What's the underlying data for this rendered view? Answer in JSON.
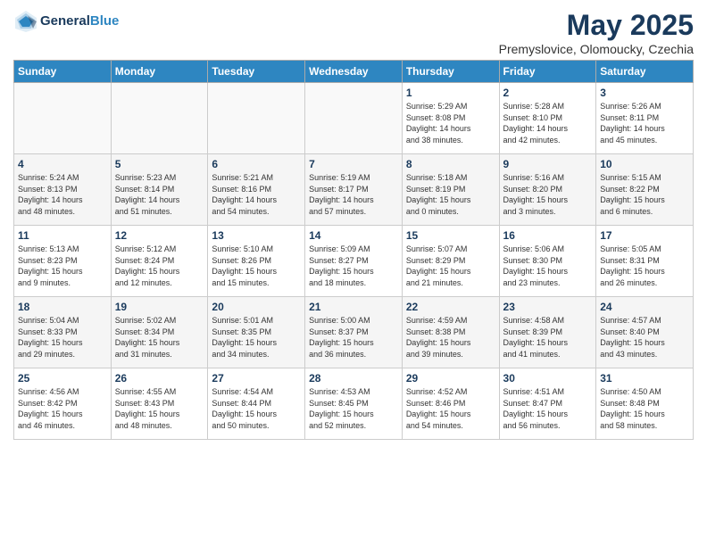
{
  "header": {
    "logo_line1": "General",
    "logo_line2": "Blue",
    "title": "May 2025",
    "subtitle": "Premyslovice, Olomoucky, Czechia"
  },
  "weekdays": [
    "Sunday",
    "Monday",
    "Tuesday",
    "Wednesday",
    "Thursday",
    "Friday",
    "Saturday"
  ],
  "weeks": [
    [
      {
        "day": "",
        "info": ""
      },
      {
        "day": "",
        "info": ""
      },
      {
        "day": "",
        "info": ""
      },
      {
        "day": "",
        "info": ""
      },
      {
        "day": "1",
        "info": "Sunrise: 5:29 AM\nSunset: 8:08 PM\nDaylight: 14 hours\nand 38 minutes."
      },
      {
        "day": "2",
        "info": "Sunrise: 5:28 AM\nSunset: 8:10 PM\nDaylight: 14 hours\nand 42 minutes."
      },
      {
        "day": "3",
        "info": "Sunrise: 5:26 AM\nSunset: 8:11 PM\nDaylight: 14 hours\nand 45 minutes."
      }
    ],
    [
      {
        "day": "4",
        "info": "Sunrise: 5:24 AM\nSunset: 8:13 PM\nDaylight: 14 hours\nand 48 minutes."
      },
      {
        "day": "5",
        "info": "Sunrise: 5:23 AM\nSunset: 8:14 PM\nDaylight: 14 hours\nand 51 minutes."
      },
      {
        "day": "6",
        "info": "Sunrise: 5:21 AM\nSunset: 8:16 PM\nDaylight: 14 hours\nand 54 minutes."
      },
      {
        "day": "7",
        "info": "Sunrise: 5:19 AM\nSunset: 8:17 PM\nDaylight: 14 hours\nand 57 minutes."
      },
      {
        "day": "8",
        "info": "Sunrise: 5:18 AM\nSunset: 8:19 PM\nDaylight: 15 hours\nand 0 minutes."
      },
      {
        "day": "9",
        "info": "Sunrise: 5:16 AM\nSunset: 8:20 PM\nDaylight: 15 hours\nand 3 minutes."
      },
      {
        "day": "10",
        "info": "Sunrise: 5:15 AM\nSunset: 8:22 PM\nDaylight: 15 hours\nand 6 minutes."
      }
    ],
    [
      {
        "day": "11",
        "info": "Sunrise: 5:13 AM\nSunset: 8:23 PM\nDaylight: 15 hours\nand 9 minutes."
      },
      {
        "day": "12",
        "info": "Sunrise: 5:12 AM\nSunset: 8:24 PM\nDaylight: 15 hours\nand 12 minutes."
      },
      {
        "day": "13",
        "info": "Sunrise: 5:10 AM\nSunset: 8:26 PM\nDaylight: 15 hours\nand 15 minutes."
      },
      {
        "day": "14",
        "info": "Sunrise: 5:09 AM\nSunset: 8:27 PM\nDaylight: 15 hours\nand 18 minutes."
      },
      {
        "day": "15",
        "info": "Sunrise: 5:07 AM\nSunset: 8:29 PM\nDaylight: 15 hours\nand 21 minutes."
      },
      {
        "day": "16",
        "info": "Sunrise: 5:06 AM\nSunset: 8:30 PM\nDaylight: 15 hours\nand 23 minutes."
      },
      {
        "day": "17",
        "info": "Sunrise: 5:05 AM\nSunset: 8:31 PM\nDaylight: 15 hours\nand 26 minutes."
      }
    ],
    [
      {
        "day": "18",
        "info": "Sunrise: 5:04 AM\nSunset: 8:33 PM\nDaylight: 15 hours\nand 29 minutes."
      },
      {
        "day": "19",
        "info": "Sunrise: 5:02 AM\nSunset: 8:34 PM\nDaylight: 15 hours\nand 31 minutes."
      },
      {
        "day": "20",
        "info": "Sunrise: 5:01 AM\nSunset: 8:35 PM\nDaylight: 15 hours\nand 34 minutes."
      },
      {
        "day": "21",
        "info": "Sunrise: 5:00 AM\nSunset: 8:37 PM\nDaylight: 15 hours\nand 36 minutes."
      },
      {
        "day": "22",
        "info": "Sunrise: 4:59 AM\nSunset: 8:38 PM\nDaylight: 15 hours\nand 39 minutes."
      },
      {
        "day": "23",
        "info": "Sunrise: 4:58 AM\nSunset: 8:39 PM\nDaylight: 15 hours\nand 41 minutes."
      },
      {
        "day": "24",
        "info": "Sunrise: 4:57 AM\nSunset: 8:40 PM\nDaylight: 15 hours\nand 43 minutes."
      }
    ],
    [
      {
        "day": "25",
        "info": "Sunrise: 4:56 AM\nSunset: 8:42 PM\nDaylight: 15 hours\nand 46 minutes."
      },
      {
        "day": "26",
        "info": "Sunrise: 4:55 AM\nSunset: 8:43 PM\nDaylight: 15 hours\nand 48 minutes."
      },
      {
        "day": "27",
        "info": "Sunrise: 4:54 AM\nSunset: 8:44 PM\nDaylight: 15 hours\nand 50 minutes."
      },
      {
        "day": "28",
        "info": "Sunrise: 4:53 AM\nSunset: 8:45 PM\nDaylight: 15 hours\nand 52 minutes."
      },
      {
        "day": "29",
        "info": "Sunrise: 4:52 AM\nSunset: 8:46 PM\nDaylight: 15 hours\nand 54 minutes."
      },
      {
        "day": "30",
        "info": "Sunrise: 4:51 AM\nSunset: 8:47 PM\nDaylight: 15 hours\nand 56 minutes."
      },
      {
        "day": "31",
        "info": "Sunrise: 4:50 AM\nSunset: 8:48 PM\nDaylight: 15 hours\nand 58 minutes."
      }
    ]
  ]
}
